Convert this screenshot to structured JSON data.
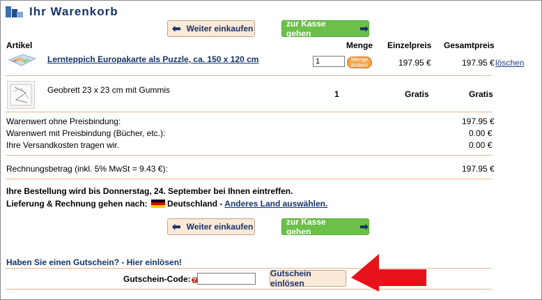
{
  "header": {
    "title": "Ihr Warenkorb"
  },
  "buttons": {
    "weiter_label": "Weiter einkaufen",
    "kasse_label": "zur Kasse gehen"
  },
  "columns": {
    "artikel": "Artikel",
    "menge": "Menge",
    "einzelpreis": "Einzelpreis",
    "gesamtpreis": "Gesamtpreis"
  },
  "items": [
    {
      "name": "Lernteppich Europakarte als Puzzle, ca. 150 x 120 cm",
      "quantity": "1",
      "menge_button_line1": "Menge",
      "menge_button_line2": "ändern",
      "einzelpreis": "197.95 €",
      "gesamtpreis": "197.95 €",
      "delete_label": "löschen"
    },
    {
      "name": "Geobrett 23 x 23 cm mit Gummis",
      "quantity": "1",
      "einzelpreis": "Gratis",
      "gesamtpreis": "Gratis"
    }
  ],
  "summary": [
    {
      "label": "Warenwert ohne Preisbindung:",
      "value": "197.95 €"
    },
    {
      "label": "Warenwert mit Preisbindung (Bücher, etc.):",
      "value": "0.00 €"
    },
    {
      "label": "Ihre Versandkosten tragen wir.",
      "value": "0.00 €"
    }
  ],
  "total": {
    "label": "Rechnungsbetrag (inkl. 5% MwSt = 9.43 €):",
    "value": "197.95 €"
  },
  "delivery": {
    "line1": "Ihre Bestellung wird bis Donnerstag, 24. September bei Ihnen eintreffen.",
    "line2_prefix": "Lieferung & Rechnung gehen nach:",
    "country": "Deutschland",
    "separator": "-",
    "change_link": "Anderes Land auswählen."
  },
  "voucher": {
    "title": "Haben Sie einen Gutschein? - Hier einlösen!",
    "code_label": "Gutschein-Code:",
    "help_symbol": "?",
    "redeem_label": "Gutschein einlösen"
  },
  "colors": {
    "brand_blue": "#14336a",
    "checkout_green": "#6cc04a",
    "divider": "#e5b68e",
    "annotation_red": "#e8121a"
  }
}
